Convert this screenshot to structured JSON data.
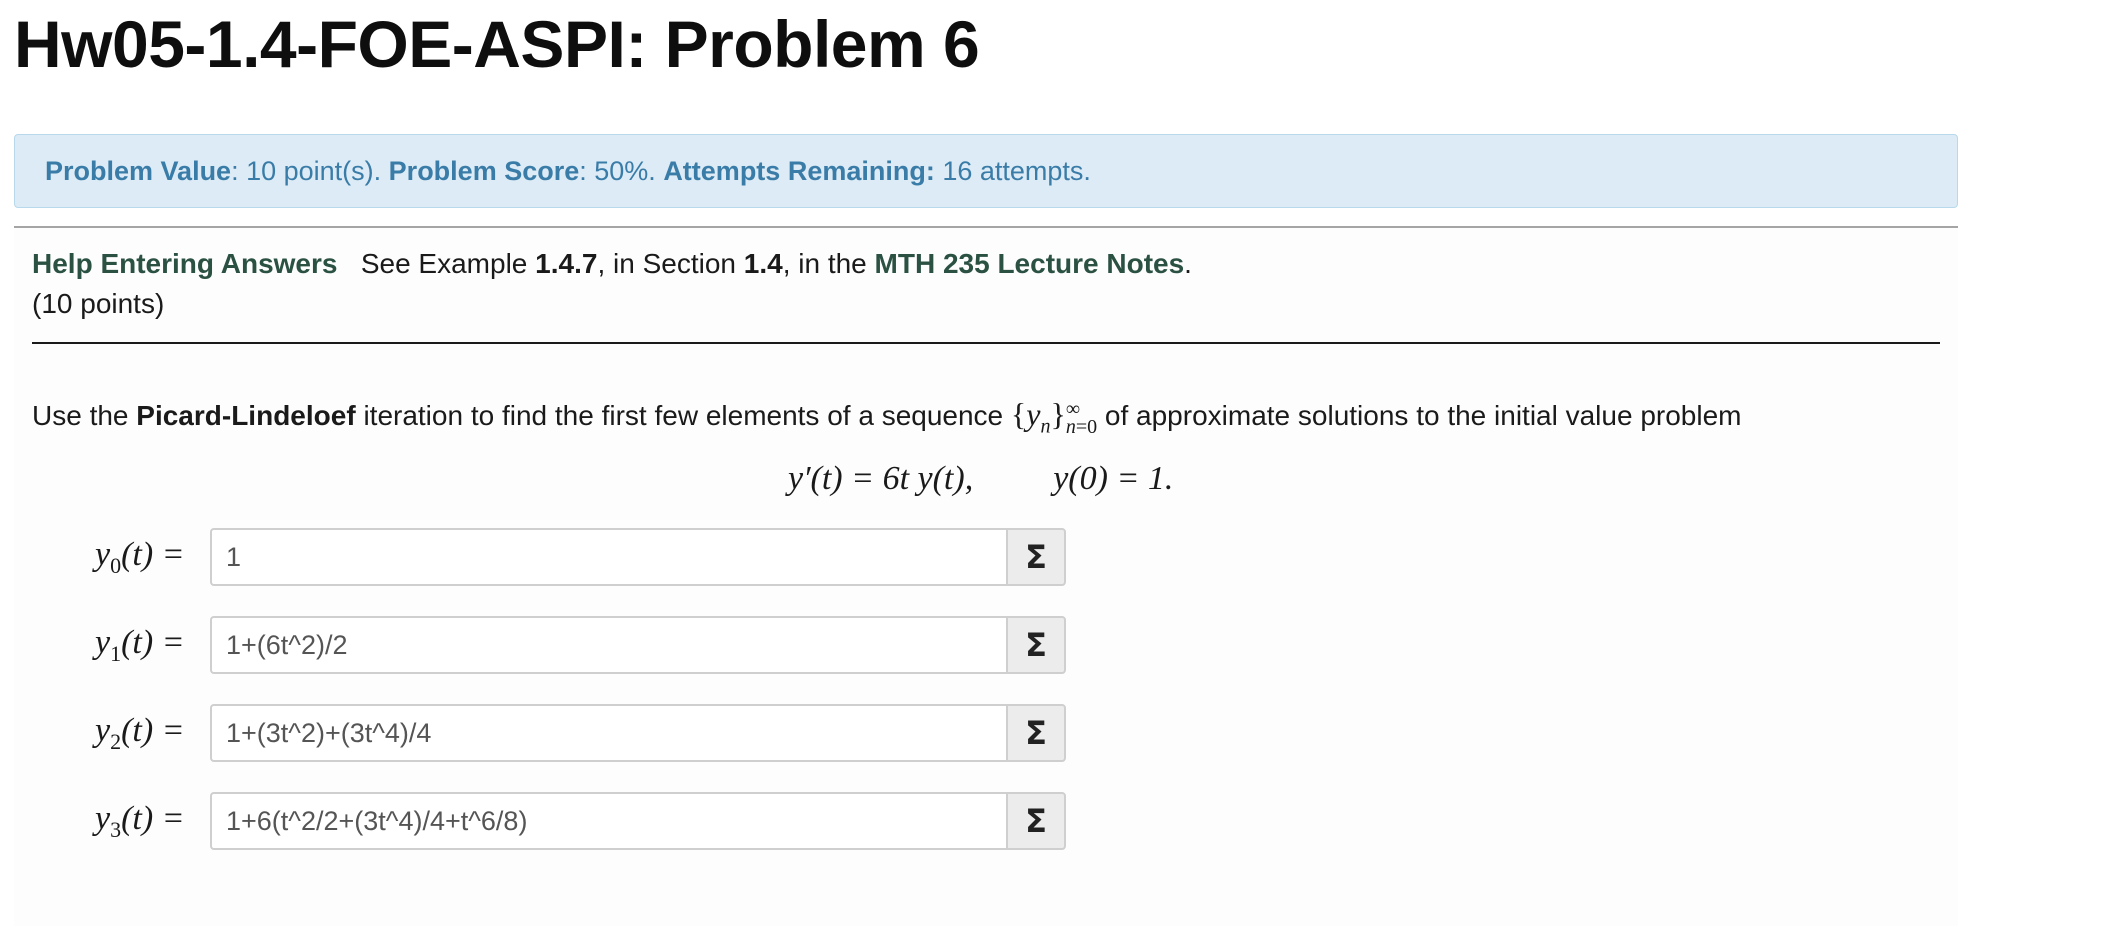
{
  "title": "Hw05-1.4-FOE-ASPI: Problem 6",
  "info": {
    "value_label": "Problem Value",
    "value_text": ": 10 point(s).",
    "score_label": "Problem Score",
    "score_text": ": 50%.",
    "attempts_label": "Attempts Remaining:",
    "attempts_text": "16 attempts."
  },
  "help": {
    "link": "Help Entering Answers",
    "see_example": "See Example",
    "example_num": "1.4.7",
    "in_section": ", in Section",
    "section_num": "1.4",
    "in_the": ", in the",
    "notes_link": "MTH 235 Lecture Notes",
    "period": "."
  },
  "points": "(10 points)",
  "problem": {
    "prefix": "Use the",
    "method": "Picard-Lindeloef",
    "middle": "iteration to find the first few elements of a sequence",
    "suffix": "of approximate solutions to the initial value problem"
  },
  "ode": {
    "lhs": "y′(t) = 6t y(t),",
    "ic": "y(0) = 1."
  },
  "answers": [
    {
      "label_var": "y",
      "label_sub": "0",
      "label_rest": "(t) =",
      "value": "1"
    },
    {
      "label_var": "y",
      "label_sub": "1",
      "label_rest": "(t) =",
      "value": "1+(6t^2)/2"
    },
    {
      "label_var": "y",
      "label_sub": "2",
      "label_rest": "(t) =",
      "value": "1+(3t^2)+(3t^4)/4"
    },
    {
      "label_var": "y",
      "label_sub": "3",
      "label_rest": "(t) =",
      "value": "1+6(t^2/2+(3t^4)/4+t^6/8)"
    }
  ],
  "icons": {
    "equation_editor": "sigma-icon",
    "equation_editor_glyph": "Σ"
  }
}
